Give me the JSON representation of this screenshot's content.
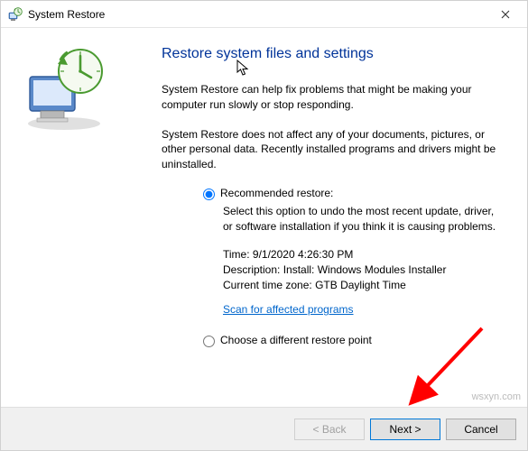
{
  "window": {
    "title": "System Restore"
  },
  "heading": "Restore system files and settings",
  "intro1": "System Restore can help fix problems that might be making your computer run slowly or stop responding.",
  "intro2": "System Restore does not affect any of your documents, pictures, or other personal data. Recently installed programs and drivers might be uninstalled.",
  "options": {
    "recommended": {
      "label": "Recommended restore:",
      "selected": true,
      "desc": "Select this option to undo the most recent update, driver, or software installation if you think it is causing problems.",
      "time_label": "Time:",
      "time_value": "9/1/2020 4:26:30 PM",
      "description_label": "Description:",
      "description_value": "Install: Windows Modules Installer",
      "tz_label": "Current time zone:",
      "tz_value": "GTB Daylight Time",
      "scan_link": "Scan for affected programs"
    },
    "different": {
      "label": "Choose a different restore point",
      "selected": false
    }
  },
  "buttons": {
    "back": "< Back",
    "next": "Next >",
    "cancel": "Cancel"
  },
  "watermark": "wsxyn.com"
}
